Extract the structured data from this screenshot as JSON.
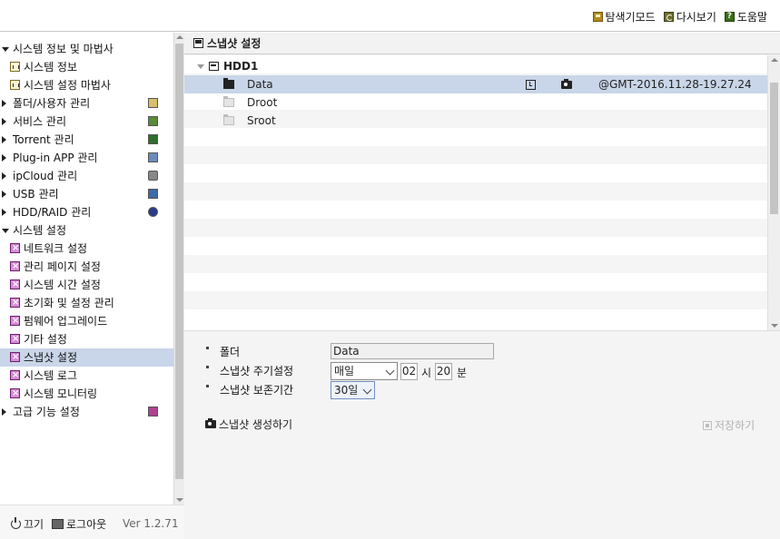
{
  "toolbar": {
    "explorer_mode": "탐색기모드",
    "reload": "다시보기",
    "help": "도움말"
  },
  "sidebar": {
    "items": [
      {
        "label": "시스템 정보 및 마법사"
      },
      {
        "label": "시스템 정보"
      },
      {
        "label": "시스템 설정 마법사"
      },
      {
        "label": "폴더/사용자 관리"
      },
      {
        "label": "서비스 관리"
      },
      {
        "label": "Torrent 관리"
      },
      {
        "label": "Plug-in APP 관리"
      },
      {
        "label": "ipCloud 관리"
      },
      {
        "label": "USB 관리"
      },
      {
        "label": "HDD/RAID 관리"
      },
      {
        "label": "시스템 설정"
      },
      {
        "label": "네트워크 설정"
      },
      {
        "label": "관리 페이지 설정"
      },
      {
        "label": "시스템 시간 설정"
      },
      {
        "label": "초기화 및 설정 관리"
      },
      {
        "label": "펌웨어 업그레이드"
      },
      {
        "label": "기타 설정"
      },
      {
        "label": "스냅샷 설정"
      },
      {
        "label": "시스템 로그"
      },
      {
        "label": "시스템 모니터링"
      },
      {
        "label": "고급 기능 설정"
      }
    ]
  },
  "footer": {
    "power_off": "끄기",
    "logout": "로그아웃",
    "version": "Ver 1.2.71"
  },
  "panel": {
    "title": "스냅샷 설정"
  },
  "tree": {
    "disk": "HDD1",
    "folders": [
      {
        "name": "Data",
        "snapshot": "@GMT-2016.11.28-19.27.24"
      },
      {
        "name": "Droot"
      },
      {
        "name": "Sroot"
      }
    ]
  },
  "settings": {
    "folder_label": "폴더",
    "folder_value": "Data",
    "period_label": "스냅샷 주기설정",
    "period_value": "매일",
    "hour_value": "02",
    "hour_unit": "시",
    "minute_value": "20",
    "minute_unit": "분",
    "retention_label": "스냅샷 보존기간",
    "retention_value": "30일",
    "create_button": "스냅샷 생성하기",
    "save_button": "저장하기"
  }
}
